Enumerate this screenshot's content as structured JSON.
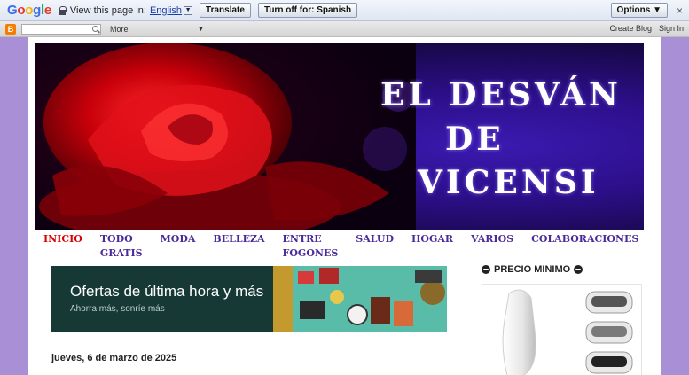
{
  "translate_bar": {
    "logo": "Google",
    "prompt": "View this page in:",
    "language": "English",
    "translate_button": "Translate",
    "turn_off_button": "Turn off for: Spanish",
    "options_button": "Options ▼",
    "close": "×"
  },
  "navbar": {
    "logo_letter": "B",
    "more": "More",
    "create_blog": "Create Blog",
    "sign_in": "Sign In"
  },
  "header": {
    "title_line1": "EL DESVÁN",
    "title_line2": "DE",
    "title_line3": "VICENSI"
  },
  "tabs": [
    {
      "label": "INICIO",
      "active": true
    },
    {
      "label": "TODO GRATIS"
    },
    {
      "label": "MODA"
    },
    {
      "label": "BELLEZA"
    },
    {
      "label": "ENTRE FOGONES"
    },
    {
      "label": "SALUD"
    },
    {
      "label": "HOGAR"
    },
    {
      "label": "VARIOS"
    },
    {
      "label": "COLABORACIONES"
    }
  ],
  "ad": {
    "headline": "Ofertas de última hora y más",
    "subline": "Ahorra más, sonríe más"
  },
  "post": {
    "date_header": "jueves, 6 de marzo de 2025"
  },
  "sidebar": {
    "widget_title": "PRECIO MINIMO"
  },
  "colors": {
    "page_background": "#a98fd6",
    "tab_color": "#4a2a9a",
    "tab_active": "#d80000",
    "ad_background": "#163936"
  }
}
